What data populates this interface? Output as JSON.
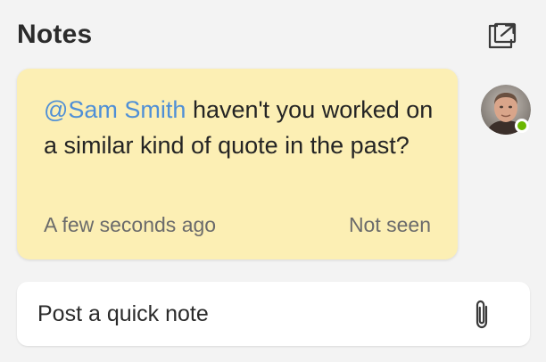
{
  "header": {
    "title": "Notes",
    "popout_icon": "open-in-new-window-icon"
  },
  "note": {
    "mention": "@Sam Smith",
    "body": " haven't you worked on a similar kind of quote in the past?",
    "timestamp": "A few seconds ago",
    "status": "Not seen",
    "background_color": "#fcefb4",
    "mention_color": "#4f8fd6"
  },
  "author": {
    "avatar_icon": "user-avatar",
    "presence": "available",
    "presence_color": "#6bb700"
  },
  "composer": {
    "placeholder": "Post a quick note",
    "attach_icon": "paperclip-icon"
  }
}
